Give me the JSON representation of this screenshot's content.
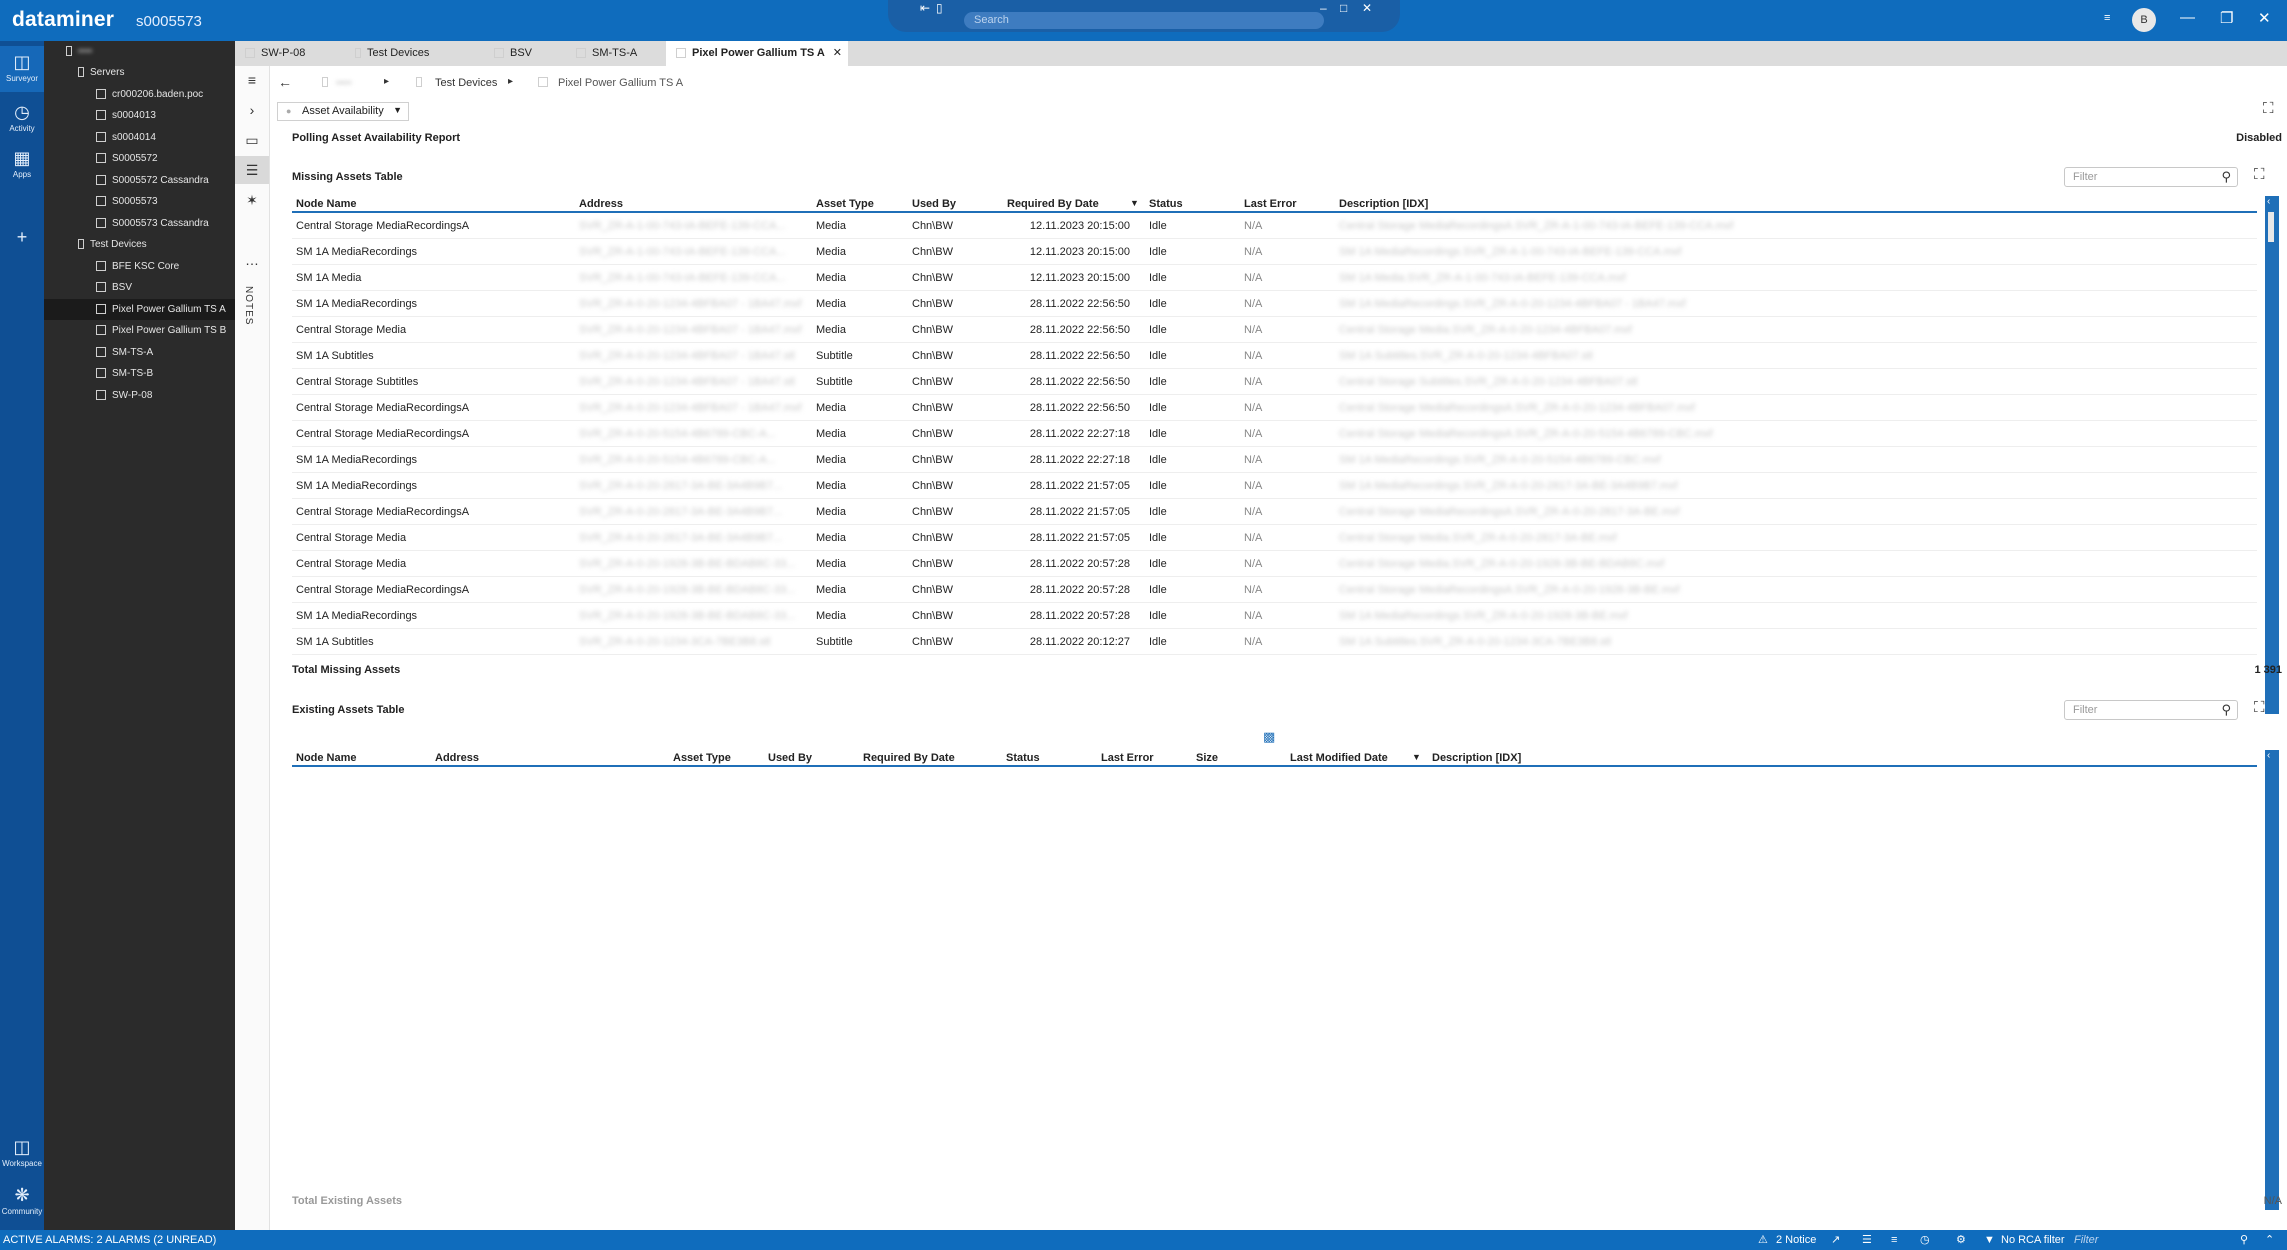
{
  "app": {
    "brand": "dataminer",
    "agent": "s0005573",
    "search_placeholder": "Search",
    "user_initial": "B"
  },
  "rail": [
    {
      "label": "Surveyor",
      "icon": "surveyor-icon"
    },
    {
      "label": "Activity",
      "icon": "activity-icon"
    },
    {
      "label": "Apps",
      "icon": "apps-icon"
    }
  ],
  "rail_bottom": [
    {
      "label": "Workspace",
      "icon": "workspace-icon"
    },
    {
      "label": "Community",
      "icon": "community-icon"
    }
  ],
  "tree": {
    "root": "▪▪▪▪",
    "servers_label": "Servers",
    "servers": [
      "cr000206.baden.poc",
      "s0004013",
      "s0004014",
      "S0005572",
      "S0005572 Cassandra",
      "S0005573",
      "S0005573 Cassandra"
    ],
    "devices_label": "Test Devices",
    "devices": [
      "BFE KSC Core",
      "BSV",
      "Pixel Power Gallium TS A",
      "Pixel Power Gallium TS B",
      "SM-TS-A",
      "SM-TS-B",
      "SW-P-08"
    ],
    "selected": "Pixel Power Gallium TS A"
  },
  "tabs": [
    "SW-P-08",
    "Test Devices",
    "BSV",
    "SM-TS-A",
    "Pixel Power Gallium TS A"
  ],
  "breadcrumb": {
    "root": "▪▪▪▪",
    "folder": "Test Devices",
    "element": "Pixel Power Gallium TS A"
  },
  "page_selector": "Asset Availability",
  "report": {
    "title": "Polling Asset Availability Report",
    "state": "Disabled"
  },
  "missing": {
    "title": "Missing Assets Table",
    "filter_placeholder": "Filter",
    "columns": [
      "Node Name",
      "Address",
      "Asset Type",
      "Used By",
      "Required By Date",
      "Status",
      "Last Error",
      "Description [IDX]"
    ],
    "rows": [
      [
        "Central Storage MediaRecordingsA",
        "SVR_ZR-A-1-00-743-IA-BEFE-139-CCA...",
        "Media",
        "Chn\\BW",
        "12.11.2023 20:15:00",
        "Idle",
        "N/A",
        "Central Storage MediaRecordingsA.SVR_ZR-A-1-00-743-IA-BEFE-139-CCA.mxf"
      ],
      [
        "SM 1A MediaRecordings",
        "SVR_ZR-A-1-00-743-IA-BEFE-139-CCA...",
        "Media",
        "Chn\\BW",
        "12.11.2023 20:15:00",
        "Idle",
        "N/A",
        "SM 1A MediaRecordings.SVR_ZR-A-1-00-743-IA-BEFE-139-CCA.mxf"
      ],
      [
        "SM 1A Media",
        "SVR_ZR-A-1-00-743-IA-BEFE-139-CCA...",
        "Media",
        "Chn\\BW",
        "12.11.2023 20:15:00",
        "Idle",
        "N/A",
        "SM 1A Media.SVR_ZR-A-1-00-743-IA-BEFE-139-CCA.mxf"
      ],
      [
        "SM 1A MediaRecordings",
        "SVR_ZR-A-0-20-1234-4BFBA07 - 1BA47.mxf",
        "Media",
        "Chn\\BW",
        "28.11.2022 22:56:50",
        "Idle",
        "N/A",
        "SM 1A MediaRecordings.SVR_ZR-A-0-20-1234-4BFBA07 - 1BA47.mxf"
      ],
      [
        "Central Storage Media",
        "SVR_ZR-A-0-20-1234-4BFBA07 - 1BA47.mxf",
        "Media",
        "Chn\\BW",
        "28.11.2022 22:56:50",
        "Idle",
        "N/A",
        "Central Storage Media.SVR_ZR-A-0-20-1234-4BFBA07.mxf"
      ],
      [
        "SM 1A Subtitles",
        "SVR_ZR-A-0-20-1234-4BFBA07 - 1BA47.stl",
        "Subtitle",
        "Chn\\BW",
        "28.11.2022 22:56:50",
        "Idle",
        "N/A",
        "SM 1A Subtitles.SVR_ZR-A-0-20-1234-4BFBA07.stl"
      ],
      [
        "Central Storage Subtitles",
        "SVR_ZR-A-0-20-1234-4BFBA07 - 1BA47.stl",
        "Subtitle",
        "Chn\\BW",
        "28.11.2022 22:56:50",
        "Idle",
        "N/A",
        "Central Storage Subtitles.SVR_ZR-A-0-20-1234-4BFBA07.stl"
      ],
      [
        "Central Storage MediaRecordingsA",
        "SVR_ZR-A-0-20-1234-4BFBA07 - 1BA47.mxf",
        "Media",
        "Chn\\BW",
        "28.11.2022 22:56:50",
        "Idle",
        "N/A",
        "Central Storage MediaRecordingsA.SVR_ZR-A-0-20-1234-4BFBA07.mxf"
      ],
      [
        "Central Storage MediaRecordingsA",
        "SVR_ZR-A-0-20-5154-4B6789-CBC-A...",
        "Media",
        "Chn\\BW",
        "28.11.2022 22:27:18",
        "Idle",
        "N/A",
        "Central Storage MediaRecordingsA.SVR_ZR-A-0-20-5154-4B6789-CBC.mxf"
      ],
      [
        "SM 1A MediaRecordings",
        "SVR_ZR-A-0-20-5154-4B6789-CBC-A...",
        "Media",
        "Chn\\BW",
        "28.11.2022 22:27:18",
        "Idle",
        "N/A",
        "SM 1A MediaRecordings.SVR_ZR-A-0-20-5154-4B6789-CBC.mxf"
      ],
      [
        "SM 1A MediaRecordings",
        "SVR_ZR-A-0-20-2817-3A-BE-3A4B9B7...",
        "Media",
        "Chn\\BW",
        "28.11.2022 21:57:05",
        "Idle",
        "N/A",
        "SM 1A MediaRecordings.SVR_ZR-A-0-20-2817-3A-BE-3A4B9B7.mxf"
      ],
      [
        "Central Storage MediaRecordingsA",
        "SVR_ZR-A-0-20-2817-3A-BE-3A4B9B7...",
        "Media",
        "Chn\\BW",
        "28.11.2022 21:57:05",
        "Idle",
        "N/A",
        "Central Storage MediaRecordingsA.SVR_ZR-A-0-20-2817-3A-BE.mxf"
      ],
      [
        "Central Storage Media",
        "SVR_ZR-A-0-20-2817-3A-BE-3A4B9B7...",
        "Media",
        "Chn\\BW",
        "28.11.2022 21:57:05",
        "Idle",
        "N/A",
        "Central Storage Media.SVR_ZR-A-0-20-2817-3A-BE.mxf"
      ],
      [
        "Central Storage Media",
        "SVR_ZR-A-0-20-1928-3B-BE-BDAB8C-33...",
        "Media",
        "Chn\\BW",
        "28.11.2022 20:57:28",
        "Idle",
        "N/A",
        "Central Storage Media.SVR_ZR-A-0-20-1928-3B-BE-BDAB8C.mxf"
      ],
      [
        "Central Storage MediaRecordingsA",
        "SVR_ZR-A-0-20-1928-3B-BE-BDAB8C-33...",
        "Media",
        "Chn\\BW",
        "28.11.2022 20:57:28",
        "Idle",
        "N/A",
        "Central Storage MediaRecordingsA.SVR_ZR-A-0-20-1928-3B-BE.mxf"
      ],
      [
        "SM 1A MediaRecordings",
        "SVR_ZR-A-0-20-1928-3B-BE-BDAB8C-33...",
        "Media",
        "Chn\\BW",
        "28.11.2022 20:57:28",
        "Idle",
        "N/A",
        "SM 1A MediaRecordings.SVR_ZR-A-0-20-1928-3B-BE.mxf"
      ],
      [
        "SM 1A Subtitles",
        "SVR_ZR-A-0-20-1234-3CA-7BE3B8.stl",
        "Subtitle",
        "Chn\\BW",
        "28.11.2022 20:12:27",
        "Idle",
        "N/A",
        "SM 1A Subtitles.SVR_ZR-A-0-20-1234-3CA-7BE3B8.stl"
      ]
    ],
    "total_label": "Total Missing Assets",
    "total_value": "1 391"
  },
  "existing": {
    "title": "Existing Assets Table",
    "filter_placeholder": "Filter",
    "columns": [
      "Node Name",
      "Address",
      "Asset Type",
      "Used By",
      "Required By Date",
      "Status",
      "Last Error",
      "Size",
      "Last Modified Date",
      "Description [IDX]"
    ],
    "total_label": "Total Existing Assets",
    "total_value": "N/A"
  },
  "statusbar": {
    "alarms": "ACTIVE ALARMS: 2 ALARMS (2 UNREAD)",
    "notice": "2 Notice",
    "rca": "No RCA filter",
    "filter_placeholder": "Filter"
  },
  "colors": {
    "accent": "#0f6cbd",
    "rail": "#0f4f94",
    "tree_bg": "#2b2b2b",
    "table_rule": "#1f6fb8"
  }
}
